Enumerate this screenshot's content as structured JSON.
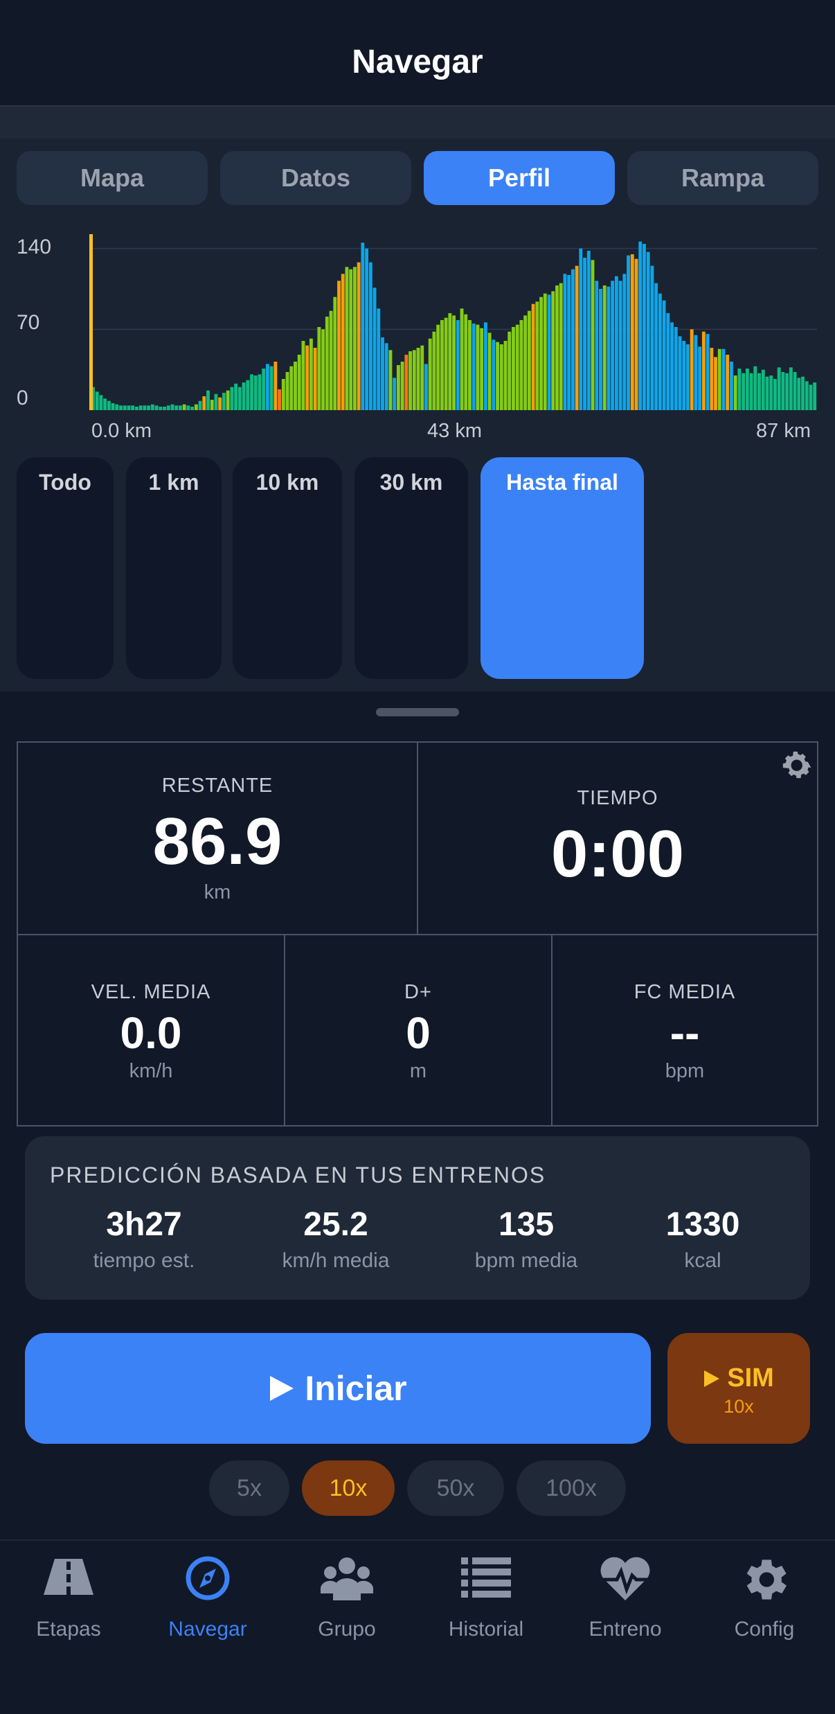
{
  "header": {
    "title": "Navegar"
  },
  "tabs": [
    {
      "label": "Mapa",
      "active": false
    },
    {
      "label": "Datos",
      "active": false
    },
    {
      "label": "Perfil",
      "active": true
    },
    {
      "label": "Rampa",
      "active": false
    }
  ],
  "chart_data": {
    "type": "bar",
    "y_ticks": [
      "140",
      "70",
      "0"
    ],
    "x_ticks": [
      "0.0 km",
      "43 km",
      "87 km"
    ],
    "xlim": [
      0,
      87
    ],
    "ylim": [
      0,
      150
    ],
    "marker_color": "#fbbf24",
    "palette": {
      "teal": "#10b981",
      "green": "#84cc16",
      "orange": "#f59e0b",
      "blue": "#0ea5e9",
      "red": "#f97316",
      "indigo": "#3b82f6"
    },
    "values": [
      20,
      16,
      13,
      10,
      8,
      6,
      5,
      4,
      4,
      4,
      4,
      3,
      4,
      4,
      4,
      5,
      4,
      3,
      3,
      4,
      5,
      4,
      4,
      5,
      4,
      3,
      5,
      8,
      12,
      17,
      9,
      14,
      11,
      15,
      17,
      20,
      23,
      20,
      24,
      26,
      31,
      30,
      31,
      36,
      40,
      38,
      42,
      18,
      27,
      33,
      38,
      42,
      48,
      60,
      56,
      62,
      54,
      72,
      70,
      81,
      86,
      98,
      112,
      118,
      124,
      122,
      124,
      128,
      145,
      140,
      128,
      106,
      88,
      63,
      58,
      52,
      28,
      39,
      42,
      48,
      51,
      52,
      54,
      56,
      40,
      62,
      68,
      74,
      78,
      80,
      84,
      82,
      78,
      88,
      83,
      78,
      75,
      74,
      71,
      76,
      67,
      61,
      59,
      57,
      60,
      68,
      72,
      74,
      78,
      82,
      86,
      92,
      94,
      98,
      101,
      100,
      103,
      108,
      110,
      118,
      117,
      122,
      125,
      140,
      132,
      138,
      130,
      112,
      105,
      108,
      107,
      112,
      116,
      112,
      118,
      134,
      135,
      131,
      146,
      144,
      137,
      125,
      110,
      101,
      95,
      84,
      76,
      72,
      64,
      60,
      57,
      70,
      65,
      55,
      68,
      66,
      54,
      46,
      53,
      53,
      48,
      42,
      30,
      36,
      32,
      36,
      32,
      38,
      32,
      35,
      29,
      30,
      27,
      37,
      33,
      32,
      37,
      33,
      28,
      29,
      25,
      22,
      24
    ],
    "colors": [
      "teal",
      "teal",
      "teal",
      "teal",
      "teal",
      "teal",
      "teal",
      "teal",
      "teal",
      "teal",
      "teal",
      "teal",
      "teal",
      "teal",
      "teal",
      "teal",
      "teal",
      "teal",
      "teal",
      "teal",
      "teal",
      "teal",
      "teal",
      "green",
      "teal",
      "teal",
      "green",
      "teal",
      "orange",
      "teal",
      "green",
      "teal",
      "orange",
      "teal",
      "green",
      "teal",
      "teal",
      "teal",
      "teal",
      "teal",
      "teal",
      "teal",
      "teal",
      "teal",
      "blue",
      "teal",
      "orange",
      "red",
      "green",
      "green",
      "green",
      "green",
      "green",
      "green",
      "orange",
      "green",
      "orange",
      "green",
      "green",
      "green",
      "green",
      "green",
      "orange",
      "orange",
      "green",
      "green",
      "green",
      "orange",
      "blue",
      "blue",
      "blue",
      "blue",
      "blue",
      "blue",
      "blue",
      "green",
      "blue",
      "green",
      "green",
      "red",
      "green",
      "green",
      "green",
      "green",
      "blue",
      "green",
      "green",
      "green",
      "green",
      "green",
      "green",
      "green",
      "blue",
      "green",
      "green",
      "green",
      "blue",
      "green",
      "green",
      "blue",
      "green",
      "blue",
      "green",
      "green",
      "green",
      "green",
      "green",
      "green",
      "green",
      "green",
      "green",
      "orange",
      "green",
      "green",
      "green",
      "blue",
      "green",
      "green",
      "green",
      "blue",
      "blue",
      "blue",
      "orange",
      "blue",
      "blue",
      "blue",
      "green",
      "blue",
      "blue",
      "green",
      "blue",
      "blue",
      "blue",
      "blue",
      "blue",
      "blue",
      "orange",
      "orange",
      "blue",
      "blue",
      "blue",
      "blue",
      "blue",
      "blue",
      "blue",
      "blue",
      "blue",
      "blue",
      "blue",
      "blue",
      "blue",
      "orange",
      "blue",
      "blue",
      "orange",
      "blue",
      "orange",
      "orange",
      "green",
      "blue",
      "orange",
      "blue",
      "green",
      "teal",
      "teal",
      "teal",
      "teal",
      "teal",
      "teal",
      "teal",
      "teal",
      "teal",
      "teal",
      "teal",
      "teal",
      "teal",
      "teal",
      "teal",
      "teal",
      "teal",
      "teal",
      "teal",
      "teal",
      "green",
      "green"
    ]
  },
  "ranges": [
    {
      "label": "Todo",
      "active": false
    },
    {
      "label": "1 km",
      "active": false
    },
    {
      "label": "10 km",
      "active": false
    },
    {
      "label": "30 km",
      "active": false
    },
    {
      "label": "Hasta final",
      "active": true
    }
  ],
  "stats": {
    "remaining": {
      "label": "RESTANTE",
      "value": "86.9",
      "unit": "km"
    },
    "time": {
      "label": "TIEMPO",
      "value": "0:00"
    },
    "avg_speed": {
      "label": "VEL. MEDIA",
      "value": "0.0",
      "unit": "km/h"
    },
    "elevation": {
      "label": "D+",
      "value": "0",
      "unit": "m"
    },
    "avg_hr": {
      "label": "FC MEDIA",
      "value": "--",
      "unit": "bpm"
    }
  },
  "prediction": {
    "title": "PREDICCIÓN BASADA EN TUS ENTRENOS",
    "items": [
      {
        "value": "3h27",
        "label": "tiempo est."
      },
      {
        "value": "25.2",
        "label": "km/h media"
      },
      {
        "value": "135",
        "label": "bpm media"
      },
      {
        "value": "1330",
        "label": "kcal"
      }
    ]
  },
  "start": {
    "label": "Iniciar"
  },
  "sim": {
    "label": "SIM",
    "speed": "10x"
  },
  "speed_chips": [
    {
      "label": "5x",
      "active": false
    },
    {
      "label": "10x",
      "active": true
    },
    {
      "label": "50x",
      "active": false
    },
    {
      "label": "100x",
      "active": false
    }
  ],
  "nav": [
    {
      "label": "Etapas",
      "icon": "road-icon",
      "active": false
    },
    {
      "label": "Navegar",
      "icon": "compass-icon",
      "active": true
    },
    {
      "label": "Grupo",
      "icon": "group-icon",
      "active": false
    },
    {
      "label": "Historial",
      "icon": "list-icon",
      "active": false
    },
    {
      "label": "Entreno",
      "icon": "heart-pulse-icon",
      "active": false
    },
    {
      "label": "Config",
      "icon": "gear-icon",
      "active": false
    }
  ],
  "colors": {
    "accent": "#3b82f6",
    "sim": "#7c3810",
    "sim_text": "#fbbf24"
  }
}
